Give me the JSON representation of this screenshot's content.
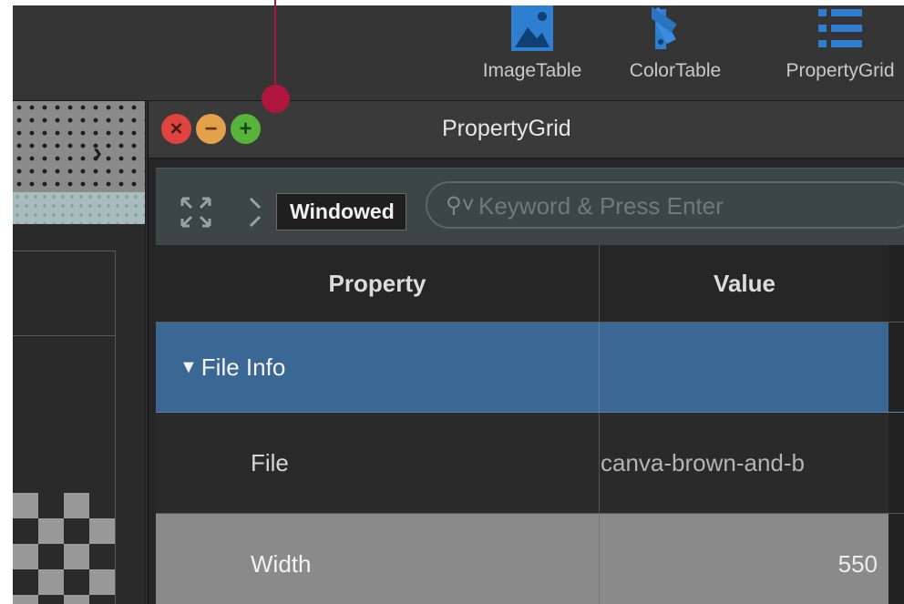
{
  "toolbar": {
    "items": [
      {
        "label": "ImageTable",
        "icon": "image-icon"
      },
      {
        "label": "ColorTable",
        "icon": "color-swatches-icon"
      },
      {
        "label": "PropertyGrid",
        "icon": "list-icon"
      }
    ]
  },
  "window": {
    "title": "PropertyGrid",
    "traffic_lights": [
      "close",
      "minimize",
      "zoom"
    ]
  },
  "search": {
    "placeholder": "Keyword & Press Enter",
    "icon": "search-icon"
  },
  "tooltip": {
    "text": "Windowed"
  },
  "table": {
    "headers": [
      "Property",
      "Value"
    ],
    "section": {
      "label": "File Info",
      "expanded": true
    },
    "rows": [
      {
        "property": "File",
        "value": "canva-brown-and-b"
      },
      {
        "property": "Width",
        "value": "550"
      }
    ]
  },
  "colors": {
    "accent_selection": "#3b6794",
    "annotation": "#b0163d",
    "close": "#e0443e",
    "minimize": "#e2a14a",
    "zoom": "#57b33a"
  }
}
